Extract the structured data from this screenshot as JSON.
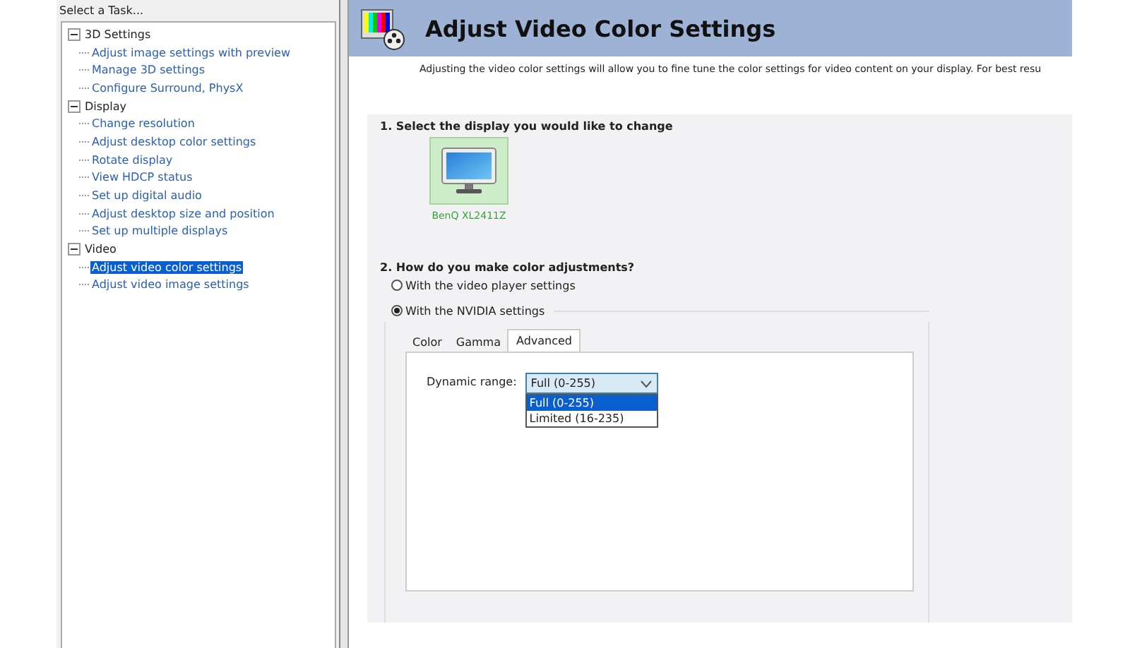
{
  "sidebar": {
    "title": "Select a Task...",
    "tree": [
      {
        "label": "3D Settings",
        "expanded": true,
        "children": [
          {
            "label": "Adjust image settings with preview",
            "selected": false
          },
          {
            "label": "Manage 3D settings",
            "selected": false
          },
          {
            "label": "Configure Surround, PhysX",
            "selected": false
          }
        ]
      },
      {
        "label": "Display",
        "expanded": true,
        "children": [
          {
            "label": "Change resolution",
            "selected": false
          },
          {
            "label": "Adjust desktop color settings",
            "selected": false
          },
          {
            "label": "Rotate display",
            "selected": false
          },
          {
            "label": "View HDCP status",
            "selected": false
          },
          {
            "label": "Set up digital audio",
            "selected": false
          },
          {
            "label": "Adjust desktop size and position",
            "selected": false
          },
          {
            "label": "Set up multiple displays",
            "selected": false
          }
        ]
      },
      {
        "label": "Video",
        "expanded": true,
        "children": [
          {
            "label": "Adjust video color settings",
            "selected": true
          },
          {
            "label": "Adjust video image settings",
            "selected": false
          }
        ]
      }
    ]
  },
  "page": {
    "title": "Adjust Video Color Settings",
    "description": "Adjusting the video color settings will allow you to fine tune the color settings for video content on your display. For best resu",
    "section_1": {
      "title": "1. Select the display you would like to change",
      "displays": [
        {
          "label": "BenQ XL2411Z",
          "selected": true
        }
      ]
    },
    "section_2": {
      "title": "2. How do you make color adjustments?",
      "options": [
        {
          "label": "With the video player settings",
          "selected": false
        },
        {
          "label": "With the NVIDIA settings",
          "selected": true
        }
      ],
      "tabs": [
        {
          "label": "Color",
          "selected": false
        },
        {
          "label": "Gamma",
          "selected": false
        },
        {
          "label": "Advanced",
          "selected": true
        }
      ],
      "dynamic_range": {
        "label": "Dynamic range:",
        "value": "Full (0-255)",
        "expanded": true,
        "options": [
          {
            "label": "Full (0-255)",
            "selected": true
          },
          {
            "label": "Limited (16-235)",
            "selected": false
          }
        ]
      }
    }
  }
}
